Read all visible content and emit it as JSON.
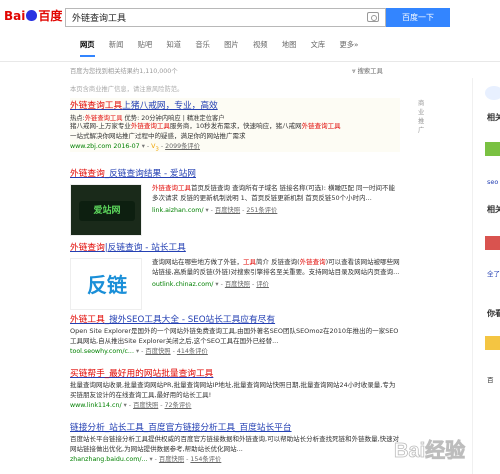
{
  "header": {
    "logo_text_left": "Bai",
    "logo_text_right": "百度",
    "query": "外链查询工具",
    "search_button": "百度一下"
  },
  "tabs": [
    "网页",
    "新闻",
    "贴吧",
    "知道",
    "音乐",
    "图片",
    "视频",
    "地图",
    "文库",
    "更多»"
  ],
  "info": {
    "result_count": "百度为您找到相关结果约1,110,000个",
    "tools": "搜索工具",
    "ad_note": "本页含商业推广信息，请注意风险防范。"
  },
  "results": [
    {
      "title_pre": "外链查询工具",
      "title_post": "上猪八戒网，专业，高效",
      "line1_hot": "热点:",
      "line1_hl": "外链查询工具",
      "line1_rest": "   优势: 20分钟内响应 | 精准定位客户",
      "abs_a": "猪八戒网-上万家专业",
      "abs_b": "外链查询工具",
      "abs_c": "服务商，10秒发布需求，快速响应，猪八戒网",
      "abs_d": "外链查询工具",
      "abs_e": "一站式解决你网站推广过程中的疑惑，满足你的网站推广需求",
      "url": "www.zbj.com  2016-07",
      "rating": "2099条评价",
      "ad_label": "商业推广"
    },
    {
      "title_pre": "外链查询",
      "title_post": "_反链查询结果 - 爱站网",
      "abs_hl": "外链查询工具",
      "abs": "首页反链查询 查询所有子域名 链接名称(可选): 横瞰匹配 同一时间不能多次请求 反链的更新机制说明 1、首页反链更新机制 首页反链50个小时内...",
      "url": "link.aizhan.com/",
      "snapshot": "百度快照",
      "rating": "251条评价",
      "thumb_text": "爱站网"
    },
    {
      "title_pre": "外链查询",
      "title_post": "|反链查询 - 站长工具",
      "abs_a": "查询网站在哪些地方做了外链，",
      "abs_hl": "工具",
      "abs_b": "简介 反链查询(",
      "abs_hl2": "外链查询",
      "abs_c": ")可以查看该网站被哪些网站链接,高质量的反链(外链)对搜索引擎排名至关重要。支持网站目录及网站内页查询...",
      "url": "outlink.chinaz.com/",
      "snapshot": "百度快照",
      "rating": "评价",
      "thumb_text": "反链"
    },
    {
      "title_pre": "外链工具",
      "title_post": "_搜外SEO工具大全 - SEO站长工具应有尽有",
      "abs": "Open Site Explorer是国外的一个网站外链免费查询工具,由国外著名SEO团队SEOmoz在2010年推出的一家SEO工具网站,自从推出Site Explorer关闭之后,这个SEO工具在国外已经替...",
      "url": "tool.seowhy.com/c...",
      "snapshot": "百度快照",
      "rating": "414条评价"
    },
    {
      "title_pre": "买链帮手_最好用的网站批量查询工具",
      "title_post": "",
      "abs": "批量查询网站收录,批量查询网站PR,批量查询网站IP地址,批量查询网站快照日期,批量查询网站24小时收录量,专为买链朋友设计的在线查询工具,最好用的站长工具!",
      "url": "www.link114.cn/",
      "snapshot": "百度快照",
      "rating": "72条评价"
    },
    {
      "title_pre": "链接分析_站长工具_百度官方链接分析工具_百度站长平台",
      "title_post": "",
      "abs": "百度站长平台链接分析工具提供权威的百度官方链接数据和外链查询,可以帮助站长分析查找死链和外链数量,快速对网站链接做出优化,为网站提供数据参考,帮助站长优化网站...",
      "url": "zhanzhang.baidu.com/...",
      "snapshot": "百度快照",
      "rating": "154条评价"
    }
  ],
  "sidebar": {
    "titles": [
      "相关",
      "相关",
      "你看"
    ],
    "snippets": [
      "seo",
      "全了",
      "百"
    ]
  },
  "watermark": "Bai经验"
}
